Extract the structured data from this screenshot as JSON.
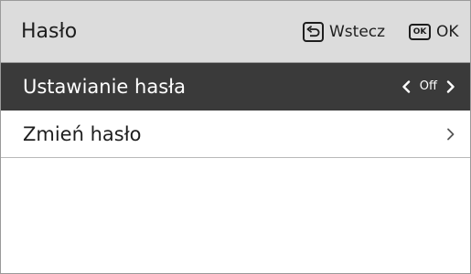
{
  "header": {
    "title": "Hasło",
    "back_label": "Wstecz",
    "ok_key_text": "OK",
    "ok_label": "OK"
  },
  "rows": [
    {
      "label": "Ustawianie hasła",
      "value": "Off",
      "selected": true
    },
    {
      "label": "Zmień hasło",
      "value": "",
      "selected": false
    }
  ],
  "icons": {
    "back": "return-arrow-icon",
    "left": "chevron-left-icon",
    "right": "chevron-right-icon"
  },
  "colors": {
    "header_bg": "#dcdcdc",
    "selected_row_bg": "#3a3a3a",
    "text_dark": "#1e1e1e",
    "text_light": "#ffffff"
  }
}
